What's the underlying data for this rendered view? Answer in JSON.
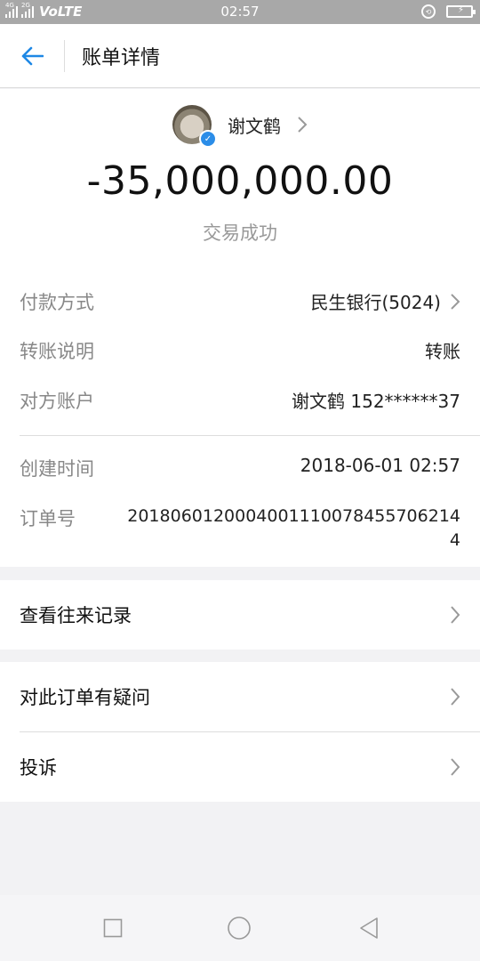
{
  "status_bar": {
    "network_1": "4G",
    "network_2": "2G",
    "carrier_label": "VoLTE",
    "time": "02:57"
  },
  "header": {
    "title": "账单详情"
  },
  "summary": {
    "payee_name": "谢文鹤",
    "amount": "-35,000,000.00",
    "status": "交易成功"
  },
  "details": {
    "payment_method_label": "付款方式",
    "payment_method_value": "民生银行(5024)",
    "transfer_note_label": "转账说明",
    "transfer_note_value": "转账",
    "counterparty_label": "对方账户",
    "counterparty_value": "谢文鹤 152******37",
    "created_time_label": "创建时间",
    "created_time_value": "2018-06-01 02:57",
    "order_no_label": "订单号",
    "order_no_value": "2018060120004001110078455706214 4"
  },
  "actions": {
    "history": "查看往来记录",
    "question": "对此订单有疑问",
    "complaint": "投诉"
  },
  "colors": {
    "accent": "#1e88e5",
    "status_bar": "#a8a8a8",
    "battery": "#34c759"
  }
}
